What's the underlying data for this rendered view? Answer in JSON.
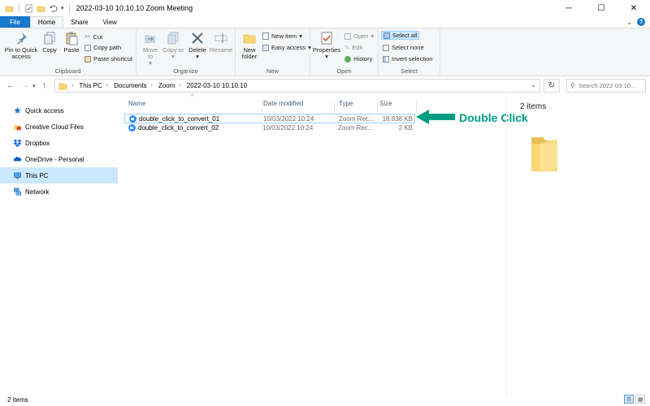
{
  "window": {
    "title": "2022-03-10 10.10.10 Zoom Meeting",
    "minimize": "─",
    "maximize": "☐",
    "close": "✕"
  },
  "ribbon_tabs": [
    "File",
    "Home",
    "Share",
    "View"
  ],
  "ribbon": {
    "clipboard": {
      "label": "Clipboard",
      "pin": "Pin to Quick access",
      "copy": "Copy",
      "paste": "Paste",
      "cut": "Cut",
      "copy_path": "Copy path",
      "paste_shortcut": "Paste shortcut"
    },
    "organize": {
      "label": "Organize",
      "move_to": "Move to",
      "copy_to": "Copy to",
      "delete": "Delete",
      "rename": "Rename"
    },
    "new": {
      "label": "New",
      "new_folder": "New folder",
      "new_item": "New item",
      "easy_access": "Easy access"
    },
    "open": {
      "label": "Open",
      "properties": "Properties",
      "open": "Open",
      "edit": "Edit",
      "history": "History"
    },
    "select": {
      "label": "Select",
      "select_all": "Select all",
      "select_none": "Select none",
      "invert_selection": "Invert selection"
    }
  },
  "address": {
    "crumbs": [
      "This PC",
      "Documents",
      "Zoom",
      "2022-03-10 10.10.10"
    ],
    "search_placeholder": "Search 2022-03-10..."
  },
  "nav_pane": [
    {
      "label": "Quick access",
      "icon": "star-icon",
      "selected": false
    },
    {
      "label": "Creative Cloud Files",
      "icon": "creative-cloud-icon",
      "selected": false
    },
    {
      "label": "Dropbox",
      "icon": "dropbox-icon",
      "selected": false
    },
    {
      "label": "OneDrive - Personal",
      "icon": "onedrive-icon",
      "selected": false
    },
    {
      "label": "This PC",
      "icon": "computer-icon",
      "selected": true
    },
    {
      "label": "Network",
      "icon": "network-icon",
      "selected": false
    }
  ],
  "columns": {
    "name": "Name",
    "date": "Date modified",
    "type": "Type",
    "size": "Size"
  },
  "files": [
    {
      "name": "double_click_to_convert_01",
      "date": "10/03/2022 10:24",
      "type": "Zoom Rec...",
      "size": "18.838 KB"
    },
    {
      "name": "double_click_to_convert_02",
      "date": "10/03/2022 10:24",
      "type": "Zoom Rec...",
      "size": "2 KB"
    }
  ],
  "annotation": {
    "text": "Double Click",
    "color": "#009d82"
  },
  "preview": {
    "count": "2 items"
  },
  "status": {
    "count": "2 items"
  },
  "colors": {
    "accent": "#1979ca",
    "selection": "#cce8ff",
    "zoom": "#2d8cff",
    "folder": "#f8d775"
  }
}
